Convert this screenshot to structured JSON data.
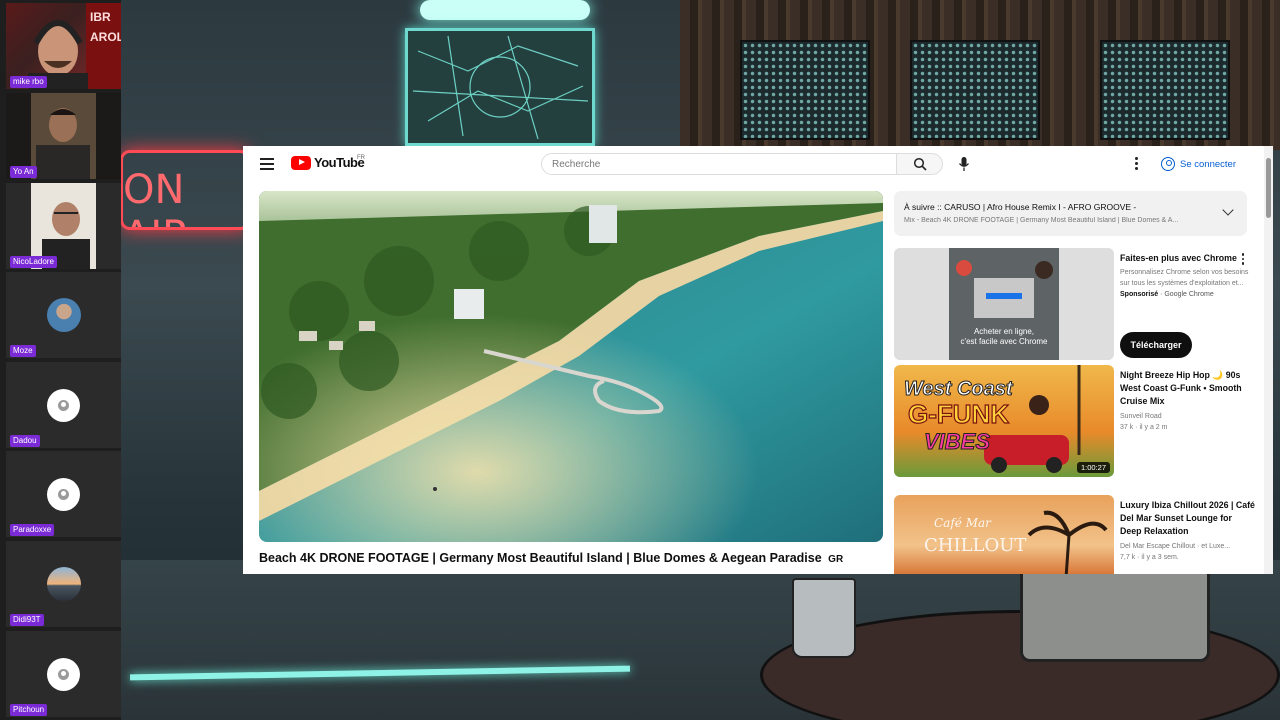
{
  "meeting": {
    "participants": [
      {
        "name": "mike rbo",
        "type": "video"
      },
      {
        "name": "Yo An",
        "type": "video"
      },
      {
        "name": "NicoLadore",
        "type": "video"
      },
      {
        "name": "Moze",
        "type": "photo"
      },
      {
        "name": "Dadou",
        "type": "placeholder"
      },
      {
        "name": "Paradoxxe",
        "type": "placeholder"
      },
      {
        "name": "Didi93T",
        "type": "photo"
      },
      {
        "name": "Pitchoun",
        "type": "placeholder"
      }
    ],
    "background_sign": "ON AIR"
  },
  "youtube": {
    "logo_text": "YouTube",
    "logo_region": "FR",
    "search": {
      "placeholder": "Recherche",
      "value": ""
    },
    "signin_label": "Se connecter",
    "video": {
      "title": "Beach 4K DRONE FOOTAGE | Germany Most Beautiful Island | Blue Domes & Aegean Paradise",
      "flag": "GR"
    },
    "queue": {
      "title": "À suivre :: CARUSO | Afro House Remix I - AFRO GROOVE -",
      "subtitle": "Mix - Beach 4K DRONE FOOTAGE | Germany Most Beautiful Island | Blue Domes & A..."
    },
    "recommendations": [
      {
        "kind": "ad",
        "title": "Faites-en plus avec Chrome",
        "description": "Personnalisez Chrome selon vos besoins sur tous les systèmes d'exploitation et...",
        "sponsor_label": "Sponsorisé",
        "sponsor_name": "Google Chrome",
        "button_label": "Télécharger",
        "thumb_caption_1": "Acheter en ligne,",
        "thumb_caption_2": "c'est facile avec Chrome"
      },
      {
        "kind": "video",
        "title": "Night Breeze Hip Hop 🌙 90s West Coast G-Funk • Smooth Cruise Mix",
        "channel": "Sunveil Road",
        "stats": "37 k · il y a 2 m",
        "duration": "1:00:27",
        "thumb_text_1": "West Coast",
        "thumb_text_2": "G-FUNK",
        "thumb_text_3": "VIBES"
      },
      {
        "kind": "video",
        "title": "Luxury Ibiza Chillout 2026 | Café Del Mar Sunset Lounge for Deep Relaxation",
        "channel": "Del Mar Escape Chillout · et Luxe...",
        "stats": "7,7 k · il y a 3 sem.",
        "thumb_text_1": "Café Mar",
        "thumb_text_2": "CHILLOUT"
      }
    ]
  },
  "colors": {
    "youtube_red": "#ff0000",
    "link_blue": "#065fd4",
    "name_tag_purple": "#7b2bd6"
  },
  "icons": [
    "hamburger-icon",
    "youtube-logo-icon",
    "search-icon",
    "mic-icon",
    "more-vert-icon",
    "account-circle-icon",
    "chevron-down-icon"
  ]
}
